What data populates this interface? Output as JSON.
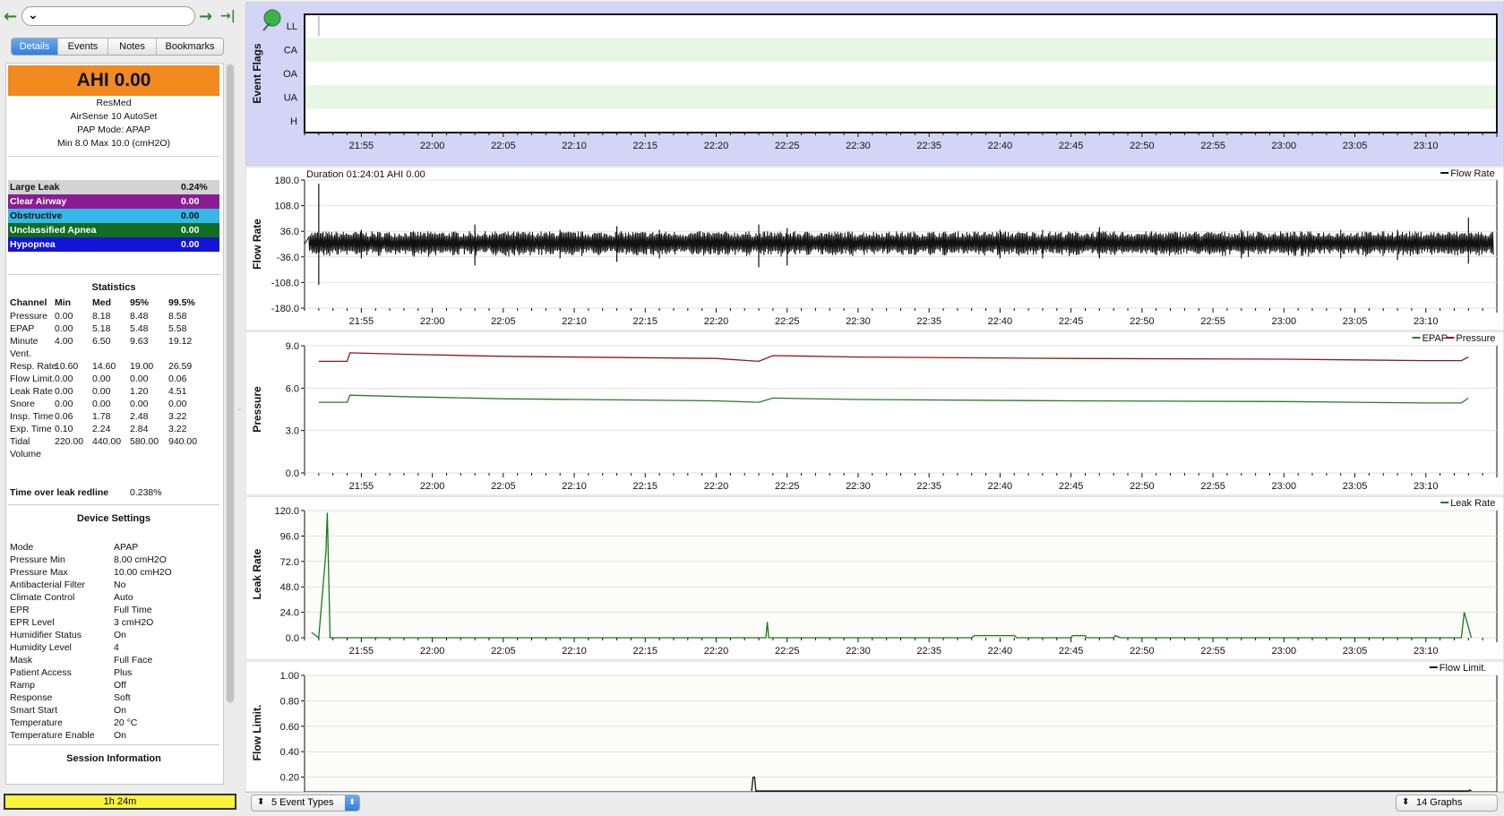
{
  "nav": {
    "back_icon": "←",
    "forward_icon": "→",
    "end_icon": "→|",
    "date_value": ""
  },
  "tabs": [
    {
      "label": "Details",
      "active": true,
      "w": 52
    },
    {
      "label": "Events",
      "active": false,
      "w": 56
    },
    {
      "label": "Notes",
      "active": false,
      "w": 54
    },
    {
      "label": "Bookmarks",
      "active": false,
      "w": 74
    }
  ],
  "details": {
    "ahi": "AHI 0.00",
    "manufacturer": "ResMed",
    "model": "AirSense 10 AutoSet",
    "pap_mode": "PAP Mode: APAP",
    "pressure_range": "Min 8.0 Max 10.0 (cmH2O)",
    "events": [
      {
        "label": "Large Leak",
        "value": "0.24%",
        "bg": "#d3d3d3",
        "fg": "#111111"
      },
      {
        "label": "Clear Airway",
        "value": "0.00",
        "bg": "#8a1d93",
        "fg": "#ffffff"
      },
      {
        "label": "Obstructive",
        "value": "0.00",
        "bg": "#35b7e8",
        "fg": "#111111"
      },
      {
        "label": "Unclassified Apnea",
        "value": "0.00",
        "bg": "#106d22",
        "fg": "#ffffff"
      },
      {
        "label": "Hypopnea",
        "value": "0.00",
        "bg": "#1414d8",
        "fg": "#ffffff"
      }
    ],
    "statistics_title": "Statistics",
    "stat_headers": [
      "Channel",
      "Min",
      "Med",
      "95%",
      "99.5%"
    ],
    "stats": [
      [
        "Pressure",
        "0.00",
        "8.18",
        "8.48",
        "8.58"
      ],
      [
        "EPAP",
        "0.00",
        "5.18",
        "5.48",
        "5.58"
      ],
      [
        "Minute",
        "4.00",
        "6.50",
        "9.63",
        "19.12"
      ],
      [
        "Vent.",
        "",
        "",
        "",
        ""
      ],
      [
        "Resp. Rate",
        "10.60",
        "14.60",
        "19.00",
        "26.59"
      ],
      [
        "Flow Limit.",
        "0.00",
        "0.00",
        "0.00",
        "0.06"
      ],
      [
        "Leak Rate",
        "0.00",
        "0.00",
        "1.20",
        "4.51"
      ],
      [
        "Snore",
        "0.00",
        "0.00",
        "0.00",
        "0.00"
      ],
      [
        "Insp. Time",
        "0.06",
        "1.78",
        "2.48",
        "3.22"
      ],
      [
        "Exp. Time",
        "0.10",
        "2.24",
        "2.84",
        "3.22"
      ],
      [
        "Tidal",
        "220.00",
        "440.00",
        "580.00",
        "940.00"
      ],
      [
        "Volume",
        "",
        "",
        "",
        ""
      ]
    ],
    "leak_redline_label": "Time over leak redline",
    "leak_redline_value": "0.238%",
    "device_settings_title": "Device Settings",
    "settings": [
      [
        "Mode",
        "APAP"
      ],
      [
        "Pressure Min",
        "8.00 cmH2O"
      ],
      [
        "Pressure Max",
        "10.00 cmH2O"
      ],
      [
        "Antibacterial Filter",
        "No"
      ],
      [
        "Climate Control",
        "Auto"
      ],
      [
        "EPR",
        "Full Time"
      ],
      [
        "EPR Level",
        "3 cmH2O"
      ],
      [
        "Humidifier Status",
        "On"
      ],
      [
        "Humidity Level",
        "4"
      ],
      [
        "Mask",
        "Full Face"
      ],
      [
        "Patient Access",
        "Plus"
      ],
      [
        "Ramp",
        "Off"
      ],
      [
        "Response",
        "Soft"
      ],
      [
        "Smart Start",
        "On"
      ],
      [
        "Temperature",
        "20 °C"
      ],
      [
        "Temperature Enable",
        "On"
      ]
    ],
    "session_info_title": "Session Information",
    "session_duration": "1h 24m"
  },
  "chart_data": [
    {
      "type": "event-flags",
      "ylabel": "Event Flags",
      "categories": [
        "LL",
        "CA",
        "OA",
        "UA",
        "H"
      ],
      "events": [
        {
          "flag": "LL",
          "time": "21:52"
        }
      ]
    },
    {
      "type": "line",
      "title": "Duration 01:24:01 AHI 0.00",
      "ylabel": "Flow Rate",
      "legend": [
        "Flow Rate"
      ],
      "yticks": [
        "180.0",
        "108.0",
        "36.0",
        "-36.0",
        "-108.0",
        "-180.0"
      ],
      "ylim": [
        -180,
        180
      ],
      "band": [
        -36,
        36
      ],
      "spikes": [
        [
          "21:52",
          170,
          -115
        ],
        [
          "21:55",
          40,
          -40
        ],
        [
          "22:03",
          55,
          -60
        ],
        [
          "22:09",
          40,
          -40
        ],
        [
          "22:13",
          50,
          -50
        ],
        [
          "22:16",
          40,
          -40
        ],
        [
          "22:23",
          55,
          -65
        ],
        [
          "22:25",
          45,
          -60
        ],
        [
          "22:40",
          40,
          -40
        ],
        [
          "22:43",
          40,
          -40
        ],
        [
          "22:47",
          48,
          -40
        ],
        [
          "22:57",
          40,
          -40
        ],
        [
          "23:04",
          40,
          -40
        ],
        [
          "23:08",
          40,
          -45
        ],
        [
          "23:13",
          75,
          -55
        ]
      ]
    },
    {
      "type": "line",
      "ylabel": "Pressure",
      "legend": [
        "EPAP",
        "Pressure"
      ],
      "yticks": [
        "9.0",
        "6.0",
        "3.0",
        "0.0"
      ],
      "ylim": [
        0,
        9
      ],
      "series": [
        {
          "name": "Pressure",
          "color": "#8b1a1a",
          "points": [
            [
              "21:52",
              7.9
            ],
            [
              "21:54",
              7.9
            ],
            [
              "21:54.2",
              8.5
            ],
            [
              "21:58",
              8.4
            ],
            [
              "22:05",
              8.25
            ],
            [
              "22:20",
              8.1
            ],
            [
              "22:23",
              7.9
            ],
            [
              "22:24",
              8.3
            ],
            [
              "22:30",
              8.2
            ],
            [
              "22:45",
              8.1
            ],
            [
              "23:00",
              8.05
            ],
            [
              "23:10",
              7.95
            ],
            [
              "23:12.5",
              7.95
            ],
            [
              "23:13",
              8.2
            ]
          ]
        },
        {
          "name": "EPAP",
          "color": "#2a7a2a",
          "points": [
            [
              "21:52",
              5.0
            ],
            [
              "21:54",
              5.0
            ],
            [
              "21:54.2",
              5.5
            ],
            [
              "21:58",
              5.4
            ],
            [
              "22:05",
              5.25
            ],
            [
              "22:20",
              5.1
            ],
            [
              "22:23",
              5.0
            ],
            [
              "22:24",
              5.3
            ],
            [
              "22:30",
              5.2
            ],
            [
              "22:45",
              5.1
            ],
            [
              "23:00",
              5.05
            ],
            [
              "23:10",
              4.95
            ],
            [
              "23:12.5",
              4.95
            ],
            [
              "23:13",
              5.3
            ]
          ]
        }
      ]
    },
    {
      "type": "line",
      "ylabel": "Leak Rate",
      "legend": [
        "Leak Rate"
      ],
      "yticks": [
        "120.0",
        "96.0",
        "72.0",
        "48.0",
        "24.0",
        "0.0"
      ],
      "ylim": [
        0,
        120
      ],
      "series": [
        {
          "name": "Leak Rate",
          "color": "#1a7a1a",
          "points": [
            [
              "21:51.5",
              5
            ],
            [
              "21:52",
              0
            ],
            [
              "21:52.5",
              80
            ],
            [
              "21:52.6",
              118
            ],
            [
              "21:52.8",
              0
            ],
            [
              "22:23.5",
              0
            ],
            [
              "22:23.6",
              15
            ],
            [
              "22:23.7",
              0
            ],
            [
              "22:38",
              0
            ],
            [
              "22:38.2",
              2
            ],
            [
              "22:41",
              2
            ],
            [
              "22:41.2",
              0
            ],
            [
              "22:45",
              0
            ],
            [
              "22:45.1",
              2
            ],
            [
              "22:46",
              2
            ],
            [
              "22:46.1",
              0
            ],
            [
              "22:48",
              0
            ],
            [
              "22:48.1",
              2
            ],
            [
              "22:48.5",
              0
            ],
            [
              "23:12.5",
              0
            ],
            [
              "23:12.7",
              24
            ],
            [
              "23:13",
              10
            ],
            [
              "23:13.2",
              0
            ]
          ]
        }
      ]
    },
    {
      "type": "line",
      "ylabel": "Flow Limit.",
      "legend": [
        "Flow Limit."
      ],
      "yticks": [
        "1.00",
        "0.80",
        "0.60",
        "0.40",
        "0.20"
      ],
      "ylim": [
        0,
        1
      ],
      "series": [
        {
          "name": "Flow Limit.",
          "color": "#111111",
          "points": [
            [
              "22:22.5",
              0
            ],
            [
              "22:22.6",
              0.2
            ],
            [
              "22:22.7",
              0.2
            ],
            [
              "22:22.8",
              0
            ],
            [
              "23:13",
              0
            ],
            [
              "23:13.1",
              0.1
            ],
            [
              "23:13.2",
              0
            ]
          ]
        }
      ]
    }
  ],
  "time_axis": {
    "start": "21:51",
    "end": "23:15",
    "ticks": [
      "21:55",
      "22:00",
      "22:05",
      "22:10",
      "22:15",
      "22:20",
      "22:25",
      "22:30",
      "22:35",
      "22:40",
      "22:45",
      "22:50",
      "22:55",
      "23:00",
      "23:05",
      "23:10"
    ]
  },
  "bottom": {
    "event_types": "5 Event Types",
    "graphs": "14 Graphs"
  },
  "colors": {
    "event_flag_bg": "#d4d4f6",
    "band_green": "#e6f7e3",
    "plot_bg": "#fcfcf8"
  }
}
